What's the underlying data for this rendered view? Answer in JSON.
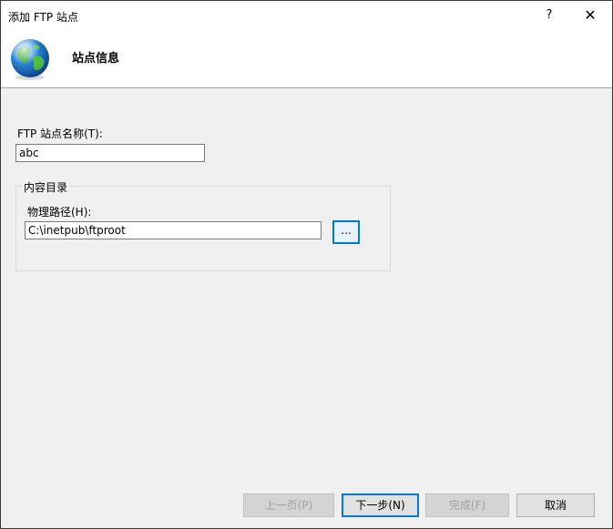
{
  "window": {
    "title": "添加 FTP 站点",
    "help_glyph": "?",
    "close_glyph": "✕"
  },
  "header": {
    "title": "站点信息",
    "icon": "globe-icon"
  },
  "form": {
    "site_name_label": "FTP 站点名称(T):",
    "site_name_value": "abc",
    "content_group_title": "内容目录",
    "physical_path_label": "物理路径(H):",
    "physical_path_value": "C:\\inetpub\\ftproot",
    "browse_label": "..."
  },
  "footer": {
    "prev_label": "上一页(P)",
    "next_label": "下一步(N)",
    "finish_label": "完成(F)",
    "cancel_label": "取消"
  },
  "colors": {
    "accent": "#0078d7",
    "dialog_bg": "#f0f0f0",
    "header_bg": "#ffffff"
  }
}
